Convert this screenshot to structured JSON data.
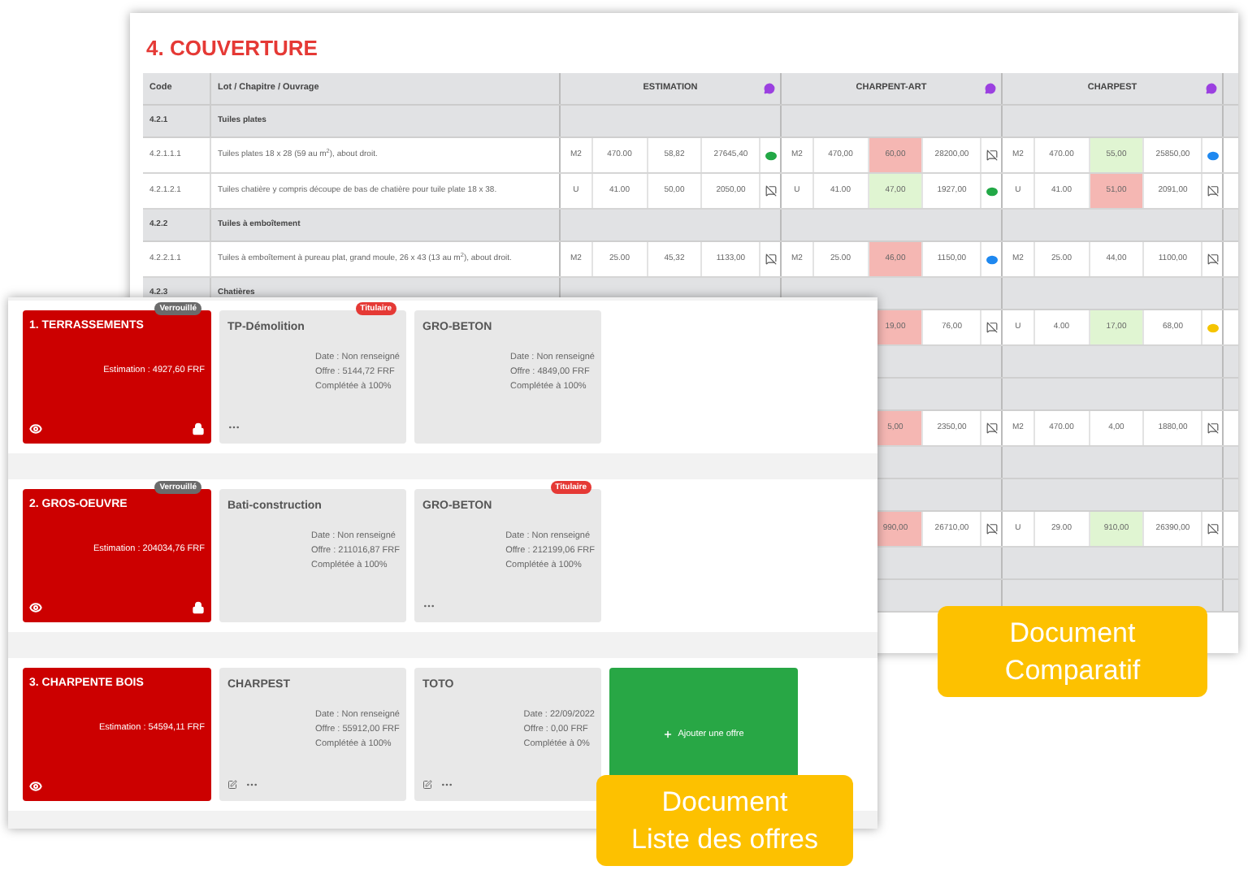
{
  "comparatif": {
    "title": "4. COUVERTURE",
    "code_header": "Code",
    "label_header": "Lot / Chapitre / Ouvrage",
    "suppliers": [
      {
        "name": "ESTIMATION"
      },
      {
        "name": "CHARPENT-ART"
      },
      {
        "name": "CHARPEST"
      }
    ],
    "rows": [
      {
        "kind": "section",
        "code": "4.2.1",
        "label": "Tuiles plates"
      },
      {
        "kind": "item",
        "code": "4.2.1.1.1",
        "label": "Tuiles plates 18 x 28 (59 au m$^{2}$), about droit.",
        "bids": [
          {
            "unit": "M2",
            "qty": "470.00",
            "price": "58,82",
            "total": "27645,40",
            "comment": {
              "kind": "dot",
              "color": "#22a846"
            }
          },
          {
            "unit": "M2",
            "qty": "470,00",
            "price": "60,00",
            "color": "#f5b7b3",
            "total": "28200,00",
            "comment": {
              "kind": "none"
            }
          },
          {
            "unit": "M2",
            "qty": "470.00",
            "price": "55,00",
            "color": "#e0f5d2",
            "total": "25850,00",
            "comment": {
              "kind": "dot",
              "color": "#1e88f0"
            }
          }
        ]
      },
      {
        "kind": "item",
        "code": "4.2.1.2.1",
        "label": "Tuiles chatière y compris découpe de bas de chatière pour tuile plate 18 x 38.",
        "bids": [
          {
            "unit": "U",
            "qty": "41.00",
            "price": "50,00",
            "total": "2050,00",
            "comment": {
              "kind": "none"
            }
          },
          {
            "unit": "U",
            "qty": "41.00",
            "price": "47,00",
            "color": "#e0f5d2",
            "total": "1927,00",
            "comment": {
              "kind": "dot",
              "color": "#22a846"
            }
          },
          {
            "unit": "U",
            "qty": "41.00",
            "price": "51,00",
            "color": "#f5b7b3",
            "total": "2091,00",
            "comment": {
              "kind": "none"
            }
          }
        ]
      },
      {
        "kind": "section",
        "code": "4.2.2",
        "label": "Tuiles à emboîtement"
      },
      {
        "kind": "item",
        "code": "4.2.2.1.1",
        "label": "Tuiles à emboîtement à pureau plat, grand moule, 26 x 43 (13 au m$^{2}$), about droit.",
        "bids": [
          {
            "unit": "M2",
            "qty": "25.00",
            "price": "45,32",
            "total": "1133,00",
            "comment": {
              "kind": "none"
            }
          },
          {
            "unit": "M2",
            "qty": "25.00",
            "price": "46,00",
            "color": "#f5b7b3",
            "total": "1150,00",
            "comment": {
              "kind": "dot",
              "color": "#1e88f0"
            }
          },
          {
            "unit": "M2",
            "qty": "25.00",
            "price": "44,00",
            "total": "1100,00",
            "comment": {
              "kind": "none"
            }
          }
        ]
      },
      {
        "kind": "section",
        "code": "4.2.3",
        "label": "Chatières"
      },
      {
        "kind": "covered_item",
        "bids": [
          {
            "price": "19,00",
            "color": "#f5b7b3",
            "total": "76,00",
            "comment": {
              "kind": "none"
            }
          },
          {
            "unit": "U",
            "qty": "4.00",
            "price": "17,00",
            "color": "#e0f5d2",
            "total": "68,00",
            "comment": {
              "kind": "dot",
              "color": "#f5c400"
            }
          }
        ]
      },
      {
        "kind": "section"
      },
      {
        "kind": "section"
      },
      {
        "kind": "covered_item",
        "bids": [
          {
            "price": "5,00",
            "color": "#f5b7b3",
            "total": "2350,00",
            "comment": {
              "kind": "none"
            }
          },
          {
            "unit": "M2",
            "qty": "470.00",
            "price": "4,00",
            "total": "1880,00",
            "comment": {
              "kind": "none"
            }
          }
        ]
      },
      {
        "kind": "section"
      },
      {
        "kind": "section"
      },
      {
        "kind": "covered_item",
        "bids": [
          {
            "price": "990,00",
            "color": "#f5b7b3",
            "total": "26710,00",
            "comment": {
              "kind": "none"
            }
          },
          {
            "unit": "U",
            "qty": "29.00",
            "price": "910,00",
            "color": "#e0f5d2",
            "total": "26390,00",
            "comment": {
              "kind": "none"
            }
          }
        ]
      },
      {
        "kind": "section"
      },
      {
        "kind": "section"
      }
    ]
  },
  "offres": {
    "lots": [
      {
        "title": "1. TERRASSEMENTS",
        "badge": "Verrouillé",
        "estimation": "Estimation : 4927,60 FRF",
        "locked": true,
        "offers": [
          {
            "name": "TP-Démolition",
            "badge": "Titulaire",
            "lines": [
              "Date : Non renseigné",
              "Offre : 5144,72 FRF",
              "Complétée à 100%"
            ],
            "editable": false,
            "menu": true
          },
          {
            "name": "GRO-BETON",
            "lines": [
              "Date : Non renseigné",
              "Offre : 4849,00 FRF",
              "Complétée à 100%"
            ],
            "editable": false,
            "menu": false
          }
        ]
      },
      {
        "title": "2. GROS-OEUVRE",
        "badge": "Verrouillé",
        "estimation": "Estimation : 204034,76 FRF",
        "locked": true,
        "offers": [
          {
            "name": "Bati-construction",
            "lines": [
              "Date : Non renseigné",
              "Offre : 211016,87 FRF",
              "Complétée à 100%"
            ],
            "editable": false,
            "menu": false
          },
          {
            "name": "GRO-BETON",
            "badge": "Titulaire",
            "lines": [
              "Date : Non renseigné",
              "Offre : 212199,06 FRF",
              "Complétée à 100%"
            ],
            "editable": false,
            "menu": true
          }
        ]
      },
      {
        "title": "3. CHARPENTE BOIS",
        "estimation": "Estimation : 54594,11 FRF",
        "locked": false,
        "offers": [
          {
            "name": "CHARPEST",
            "lines": [
              "Date : Non renseigné",
              "Offre : 55912,00 FRF",
              "Complétée à 100%"
            ],
            "editable": true,
            "menu": true
          },
          {
            "name": "TOTO",
            "lines": [
              "Date : 22/09/2022",
              "Offre : 0,00 FRF",
              "Complétée à 0%"
            ],
            "editable": true,
            "menu": true
          }
        ],
        "add_button": true
      }
    ],
    "add_label": "Ajouter une offre"
  },
  "callouts": [
    {
      "kind": "comparatif",
      "lines": [
        "Document",
        "Comparatif"
      ]
    },
    {
      "kind": "liste",
      "lines": [
        "Document",
        "Liste des offres"
      ]
    }
  ]
}
